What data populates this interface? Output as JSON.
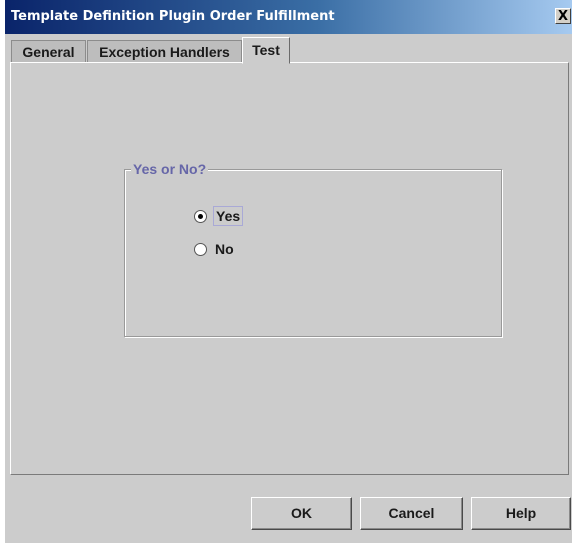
{
  "window": {
    "title": "Template Definition Plugin Order Fulfillment",
    "close_label": "X"
  },
  "tabs": [
    {
      "label": "General",
      "active": false
    },
    {
      "label": "Exception Handlers",
      "active": false
    },
    {
      "label": "Test",
      "active": true
    }
  ],
  "group": {
    "legend": "Yes or No?",
    "options": [
      {
        "label": "Yes",
        "selected": true
      },
      {
        "label": "No",
        "selected": false
      }
    ]
  },
  "buttons": {
    "ok": "OK",
    "cancel": "Cancel",
    "help": "Help"
  },
  "colors": {
    "titlebar_start": "#0a246a",
    "titlebar_end": "#a6caf0",
    "legend_text": "#6666a8",
    "window_background": "#cccccc"
  }
}
